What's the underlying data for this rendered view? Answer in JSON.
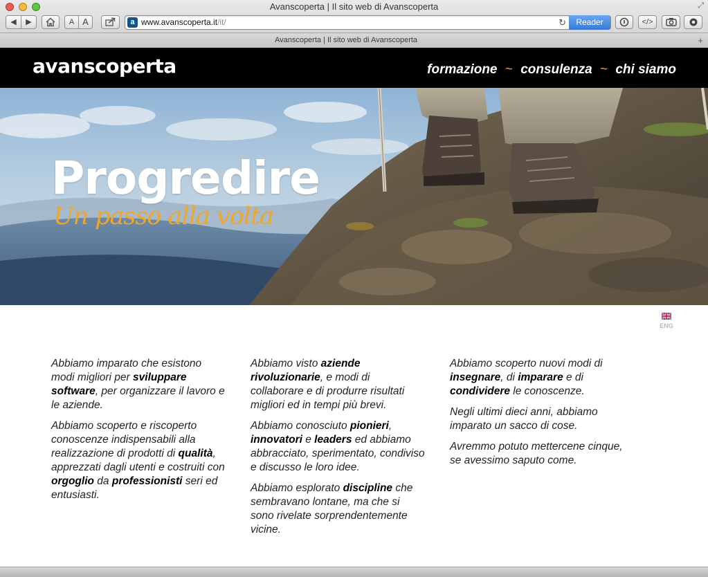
{
  "window": {
    "title": "Avanscoperta | Il sito web di Avanscoperta",
    "url_host": "www.avanscoperta.it",
    "url_path": "/it/",
    "reader_label": "Reader",
    "font_small_label": "A",
    "font_large_label": "A",
    "tab_title": "Avanscoperta | Il sito web di Avanscoperta"
  },
  "site": {
    "logo": "avanscoperta",
    "nav": [
      {
        "label": "formazione"
      },
      {
        "label": "consulenza"
      },
      {
        "label": "chi siamo"
      }
    ],
    "nav_separator": "~",
    "accent_color": "#f1a625",
    "hero": {
      "title": "Progredire",
      "tagline": "Un passo alla volta"
    },
    "language_switch": "ENG",
    "columns": [
      {
        "paragraphs": [
          [
            {
              "t": "Abbiamo imparato che esistono modi migliori per ",
              "b": false
            },
            {
              "t": "sviluppare software",
              "b": true
            },
            {
              "t": ", per organizzare il lavoro e le aziende.",
              "b": false
            }
          ],
          [
            {
              "t": "Abbiamo scoperto e riscoperto conoscenze indispensabili alla realizzazione di prodotti di ",
              "b": false
            },
            {
              "t": "qualità",
              "b": true
            },
            {
              "t": ", apprezzati dagli utenti e costruiti con ",
              "b": false
            },
            {
              "t": "orgoglio",
              "b": true
            },
            {
              "t": " da ",
              "b": false
            },
            {
              "t": "professionisti",
              "b": true
            },
            {
              "t": " seri ed entusiasti.",
              "b": false
            }
          ]
        ]
      },
      {
        "paragraphs": [
          [
            {
              "t": "Abbiamo visto ",
              "b": false
            },
            {
              "t": "aziende rivoluzionarie",
              "b": true
            },
            {
              "t": ", e modi di collaborare e di produrre risultati migliori ed in tempi più brevi.",
              "b": false
            }
          ],
          [
            {
              "t": "Abbiamo conosciuto ",
              "b": false
            },
            {
              "t": "pionieri",
              "b": true
            },
            {
              "t": ", ",
              "b": false
            },
            {
              "t": "innovatori",
              "b": true
            },
            {
              "t": " e ",
              "b": false
            },
            {
              "t": "leaders",
              "b": true
            },
            {
              "t": " ed abbiamo abbracciato, sperimentato, condiviso e discusso le loro idee.",
              "b": false
            }
          ],
          [
            {
              "t": "Abbiamo esplorato ",
              "b": false
            },
            {
              "t": "discipline",
              "b": true
            },
            {
              "t": " che sembravano lontane, ma che si sono rivelate sorprendentemente vicine.",
              "b": false
            }
          ]
        ]
      },
      {
        "paragraphs": [
          [
            {
              "t": "Abbiamo scoperto nuovi modi di ",
              "b": false
            },
            {
              "t": "insegnare",
              "b": true
            },
            {
              "t": ", di ",
              "b": false
            },
            {
              "t": "imparare",
              "b": true
            },
            {
              "t": " e di ",
              "b": false
            },
            {
              "t": "condividere",
              "b": true
            },
            {
              "t": " le conoscenze.",
              "b": false
            }
          ],
          [
            {
              "t": "Negli ultimi dieci anni, abbiamo imparato un sacco di cose.",
              "b": false
            }
          ],
          [
            {
              "t": "Avremmo potuto mettercene cinque, se avessimo saputo come.",
              "b": false
            }
          ]
        ]
      }
    ]
  }
}
